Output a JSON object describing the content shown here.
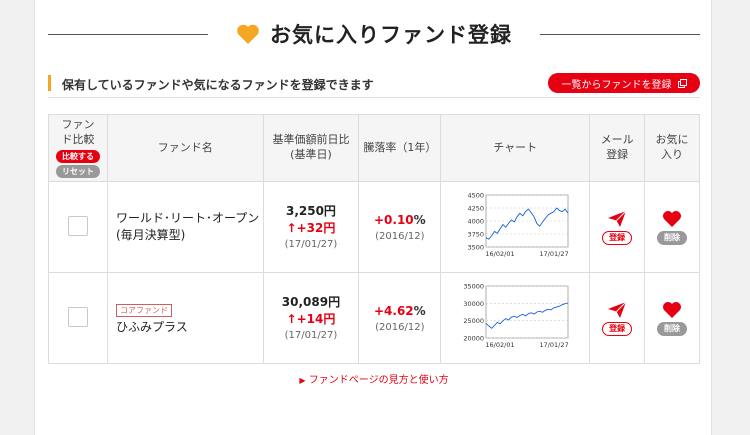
{
  "title": "お気に入りファンド登録",
  "subtitle": "保有しているファンドや気になるファンドを登録できます",
  "list_button": "一覧からファンドを登録",
  "columns": {
    "compare": "ファンド比較",
    "compare_btn": "比較する",
    "reset_btn": "リセット",
    "name": "ファンド名",
    "price_line1": "基準価額前日比",
    "price_line2": "(基準日)",
    "rate": "騰落率（1年）",
    "chart": "チャート",
    "mail_line1": "メール",
    "mail_line2": "登録",
    "fav_line1": "お気に",
    "fav_line2": "入り"
  },
  "funds": [
    {
      "tag": "",
      "name_line1": "ワールド･リート･オープン",
      "name_line2": "(毎月決算型)",
      "price": "3,250円",
      "change": "+32円",
      "date": "(17/01/27)",
      "rate": "+0.10",
      "rate_unit": "%",
      "rate_date": "(2016/12)",
      "mail_label": "登録",
      "fav_label": "削除"
    },
    {
      "tag": "コアファンド",
      "name_line1": "ひふみプラス",
      "name_line2": "",
      "price": "30,089円",
      "change": "+14円",
      "date": "(17/01/27)",
      "rate": "+4.62",
      "rate_unit": "%",
      "rate_date": "(2016/12)",
      "mail_label": "登録",
      "fav_label": "削除"
    }
  ],
  "chart_data": [
    {
      "type": "line",
      "x_ticks": [
        "16/02/01",
        "17/01/27"
      ],
      "y_ticks": [
        3500,
        3750,
        4000,
        4250,
        4500
      ],
      "ylim": [
        3500,
        4500
      ],
      "values": [
        3680,
        3650,
        3720,
        3800,
        3760,
        3850,
        3930,
        3880,
        3960,
        4020,
        3980,
        4080,
        4150,
        4100,
        4180,
        4230,
        4160,
        4080,
        3950,
        3900,
        3980,
        4050,
        4120,
        4150,
        4180,
        4250,
        4200,
        4180,
        4230,
        4150
      ],
      "color": "#1a5fd6"
    },
    {
      "type": "line",
      "x_ticks": [
        "16/02/01",
        "17/01/27"
      ],
      "y_ticks": [
        20000,
        25000,
        30000,
        35000
      ],
      "ylim": [
        20000,
        35000
      ],
      "values": [
        24200,
        23500,
        22800,
        23600,
        24500,
        24100,
        25000,
        25600,
        25200,
        26000,
        26300,
        25900,
        26500,
        26800,
        26400,
        27000,
        27300,
        26900,
        27500,
        27700,
        27400,
        28000,
        28300,
        28100,
        28700,
        28900,
        29200,
        29600,
        29900,
        30089
      ],
      "color": "#1a5fd6"
    }
  ],
  "colors": {
    "accent": "#e60012",
    "heart": "#f5a623",
    "sub_bar": "#f5a623"
  },
  "footer_link": "ファンドページの見方と使い方"
}
